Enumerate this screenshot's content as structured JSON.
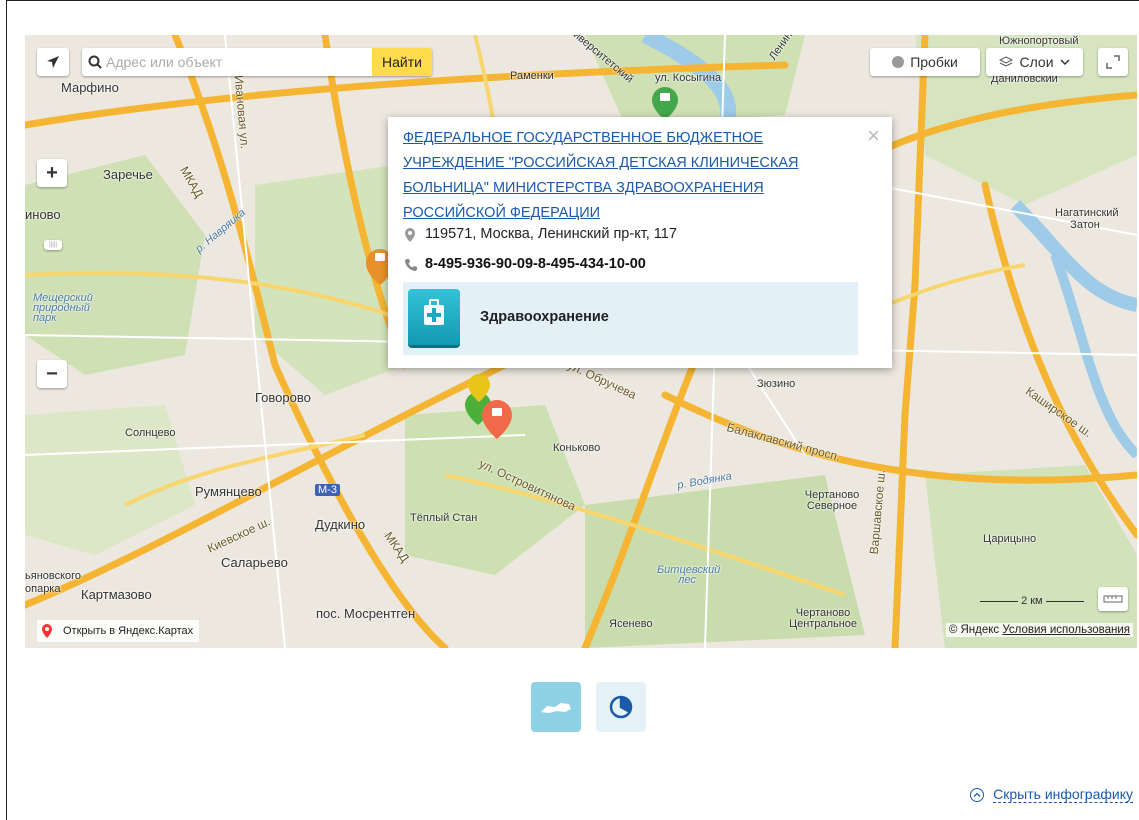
{
  "search": {
    "placeholder": "Адрес или объект",
    "button_label": "Найти"
  },
  "controls": {
    "traffic_label": "Пробки",
    "layers_label": "Слои",
    "zoom_in": "+",
    "zoom_out": "−",
    "locate_icon": "arrow-icon",
    "fullscreen_icon": "expand-icon"
  },
  "popup": {
    "title": "ФЕДЕРАЛЬНОЕ ГОСУДАРСТВЕННОЕ БЮДЖЕТНОЕ УЧРЕЖДЕНИЕ \"РОССИЙСКАЯ ДЕТСКАЯ КЛИНИЧЕСКАЯ БОЛЬНИЦА\" МИНИСТЕРСТВА ЗДРАВООХРАНЕНИЯ РОССИЙСКОЙ ФЕДЕРАЦИИ",
    "address": "119571, Москва, Ленинский пр-кт, 117",
    "phone": "8-495-936-90-09-8-495-434-10-00",
    "category": "Здравоохранение",
    "close": "×"
  },
  "map_labels": {
    "marfino": "Марфино",
    "zarechye": "Заречье",
    "inovo": "иново",
    "ramenki": "Раменки",
    "kosygina": "ул. Косыгина",
    "universitetsky": "Университетский",
    "lenin": "Ленин",
    "danilovsky": "Даниловский",
    "yuzhnoportovy": "Южнопортовый",
    "nagatinsky": "Нагатинский Затон",
    "mkad1": "МКАД",
    "ivanovskaya": "Ивановая ул.",
    "novikova": "р. Навряика",
    "mesch_park": "Мещерский природный парк",
    "govorovo": "Говорово",
    "solntsevo": "Солнцево",
    "rumyantsevo": "Румянцево",
    "dudkino": "Дудкино",
    "teply_stan": "Тёплый Стан",
    "konkovo": "Коньково",
    "obrucheva": "ул. Обручева",
    "ostrovityanova": "ул. Островитянова",
    "balaklavsky": "Балаклавский просп.",
    "zyuzino": "Зюзино",
    "kashirskoe": "Каширское ш.",
    "varshavskoe": "Варшавское ш.",
    "chertanovo_sev": "Чертаново Северное",
    "chertanovo_centr": "Чертаново Центральное",
    "tsaritsyno": "Царицыно",
    "vodyanka": "р. Водянка",
    "bitsevsky": "Битцевский лес",
    "yasenevo": "Ясенево",
    "kievskoe": "Киевское ш.",
    "mkad2": "МКАД",
    "salaryevo": "Саларьево",
    "vnukovo": "ьяновского",
    "kartmazovo": "Картмазово",
    "oparka": "опарка",
    "mosrentgen": "пос. Мосрентген",
    "m3": "М-3"
  },
  "open_in_yandex": "Открыть в Яндекс.Картах",
  "copyright_brand": "© Яндекс",
  "terms_link": "Условия использования",
  "scale_label": "2 км",
  "hide_infographic": "Скрыть инфографику",
  "colors": {
    "yellow_button": "#ffdb4d",
    "link": "#1a5aa8",
    "teal": "#1ba7c2"
  }
}
